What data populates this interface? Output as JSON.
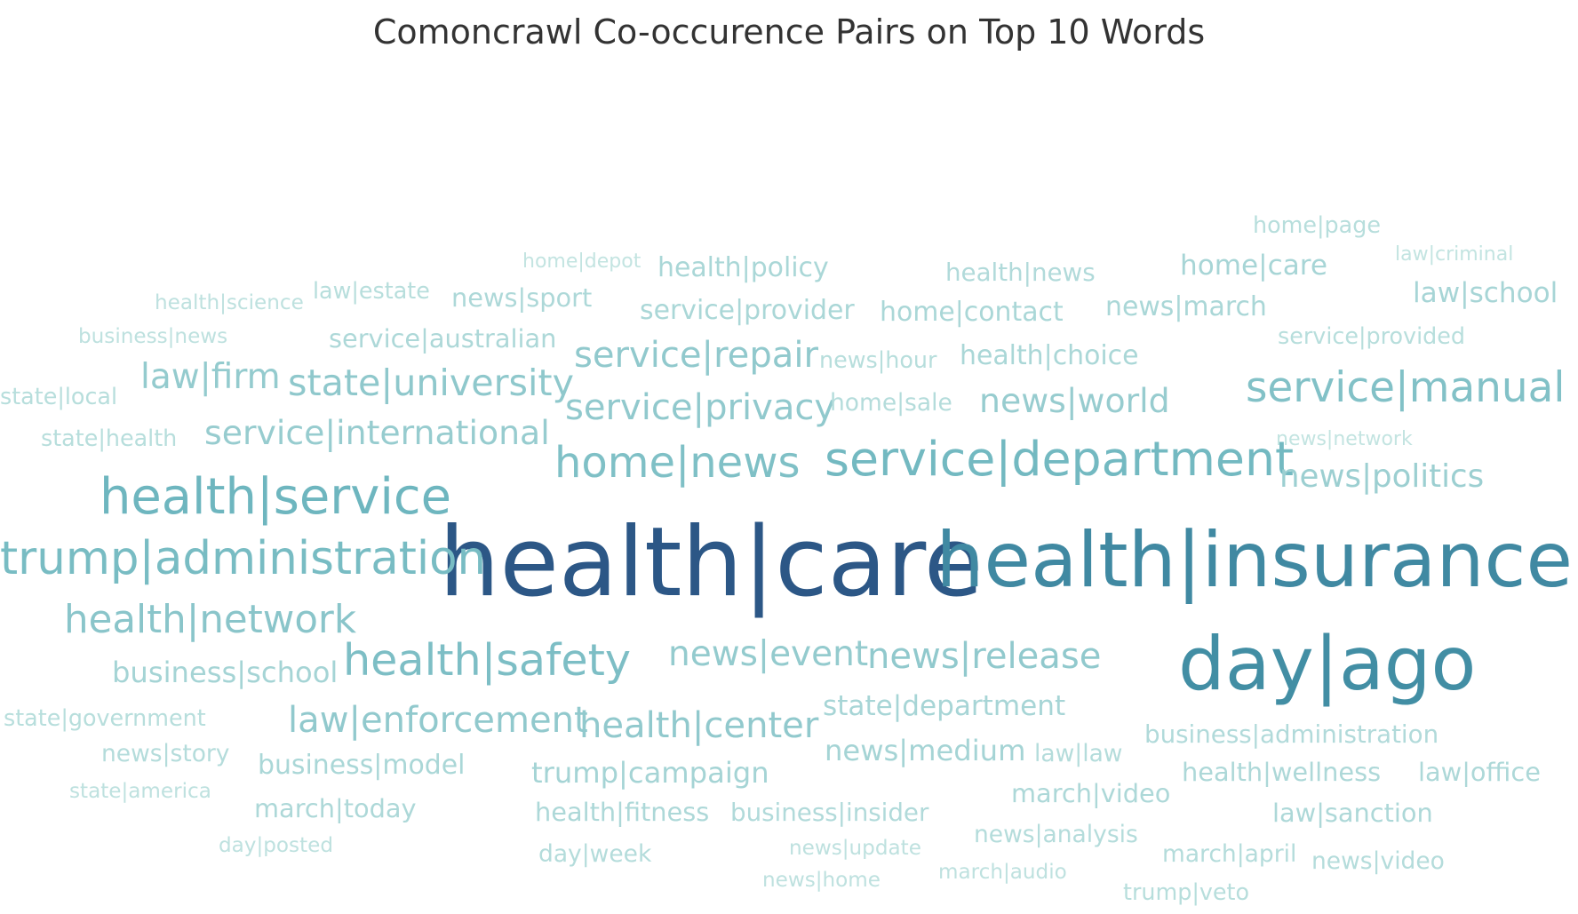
{
  "title": "Comoncrawl Co-occurence Pairs on Top 10 Words",
  "chart_data": {
    "type": "wordcloud",
    "title": "Comoncrawl Co-occurence Pairs on Top 10 Words",
    "color_scale": {
      "min": "#c3e4e1",
      "mid": "#4aa3b0",
      "max": "#2c5786"
    },
    "words": [
      {
        "text": "health|care",
        "weight": 100
      },
      {
        "text": "health|insurance",
        "weight": 80
      },
      {
        "text": "day|ago",
        "weight": 78
      },
      {
        "text": "health|service",
        "weight": 54
      },
      {
        "text": "service|department",
        "weight": 52
      },
      {
        "text": "trump|administration",
        "weight": 50
      },
      {
        "text": "health|safety",
        "weight": 48
      },
      {
        "text": "home|news",
        "weight": 47
      },
      {
        "text": "service|manual",
        "weight": 46
      },
      {
        "text": "health|network",
        "weight": 43
      },
      {
        "text": "state|university",
        "weight": 41
      },
      {
        "text": "law|enforcement",
        "weight": 40
      },
      {
        "text": "news|release",
        "weight": 40
      },
      {
        "text": "health|center",
        "weight": 40
      },
      {
        "text": "service|repair",
        "weight": 40
      },
      {
        "text": "service|privacy",
        "weight": 40
      },
      {
        "text": "news|event",
        "weight": 39
      },
      {
        "text": "law|firm",
        "weight": 39
      },
      {
        "text": "service|international",
        "weight": 38
      },
      {
        "text": "news|world",
        "weight": 38
      },
      {
        "text": "news|politics",
        "weight": 36
      },
      {
        "text": "business|school",
        "weight": 33
      },
      {
        "text": "news|medium",
        "weight": 33
      },
      {
        "text": "trump|campaign",
        "weight": 33
      },
      {
        "text": "law|school",
        "weight": 32
      },
      {
        "text": "home|care",
        "weight": 32
      },
      {
        "text": "state|department",
        "weight": 32
      },
      {
        "text": "news|march",
        "weight": 31
      },
      {
        "text": "home|contact",
        "weight": 31
      },
      {
        "text": "health|choice",
        "weight": 31
      },
      {
        "text": "service|provider",
        "weight": 31
      },
      {
        "text": "health|policy",
        "weight": 31
      },
      {
        "text": "business|model",
        "weight": 31
      },
      {
        "text": "march|today",
        "weight": 30
      },
      {
        "text": "health|fitness",
        "weight": 30
      },
      {
        "text": "law|sanction",
        "weight": 30
      },
      {
        "text": "march|video",
        "weight": 30
      },
      {
        "text": "health|wellness",
        "weight": 30
      },
      {
        "text": "law|office",
        "weight": 30
      },
      {
        "text": "service|australian",
        "weight": 30
      },
      {
        "text": "news|sport",
        "weight": 30
      },
      {
        "text": "business|insider",
        "weight": 29
      },
      {
        "text": "business|administration",
        "weight": 29
      },
      {
        "text": "health|news",
        "weight": 29
      },
      {
        "text": "news|story",
        "weight": 28
      },
      {
        "text": "day|week",
        "weight": 28
      },
      {
        "text": "news|analysis",
        "weight": 28
      },
      {
        "text": "march|april",
        "weight": 28
      },
      {
        "text": "news|video",
        "weight": 28
      },
      {
        "text": "home|sale",
        "weight": 28
      },
      {
        "text": "law|law",
        "weight": 28
      },
      {
        "text": "news|hour",
        "weight": 27
      },
      {
        "text": "law|estate",
        "weight": 27
      },
      {
        "text": "state|local",
        "weight": 27
      },
      {
        "text": "state|health",
        "weight": 27
      },
      {
        "text": "state|government",
        "weight": 27
      },
      {
        "text": "trump|veto",
        "weight": 27
      },
      {
        "text": "service|provided",
        "weight": 27
      },
      {
        "text": "home|page",
        "weight": 27
      },
      {
        "text": "state|america",
        "weight": 25
      },
      {
        "text": "day|posted",
        "weight": 25
      },
      {
        "text": "news|update",
        "weight": 25
      },
      {
        "text": "news|home",
        "weight": 25
      },
      {
        "text": "march|audio",
        "weight": 25
      },
      {
        "text": "health|science",
        "weight": 25
      },
      {
        "text": "business|news",
        "weight": 25
      },
      {
        "text": "home|depot",
        "weight": 24
      },
      {
        "text": "law|criminal",
        "weight": 24
      },
      {
        "text": "news|network",
        "weight": 24
      }
    ]
  }
}
